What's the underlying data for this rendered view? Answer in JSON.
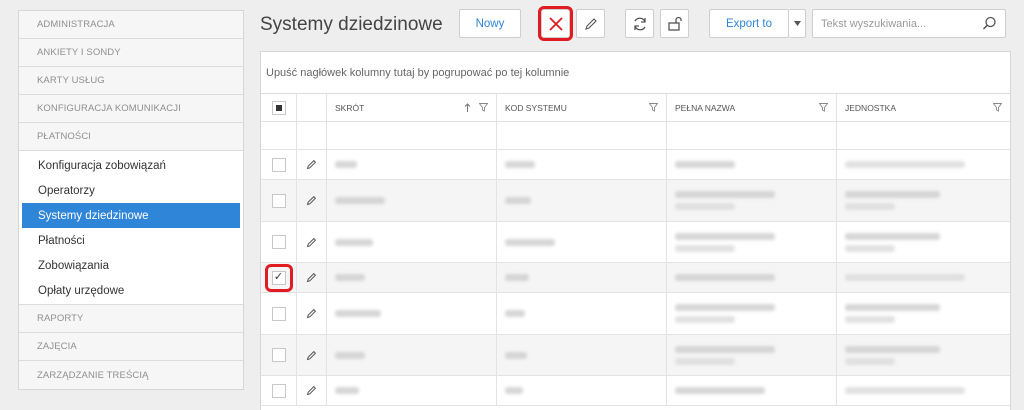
{
  "sidebar": {
    "sections_top": [
      "ADMINISTRACJA",
      "ANKIETY I SONDY",
      "KARTY USŁUG",
      "KONFIGURACJA KOMUNIKACJI",
      "PŁATNOŚCI"
    ],
    "sub_items": [
      {
        "label": "Konfiguracja zobowiązań",
        "active": false
      },
      {
        "label": "Operatorzy",
        "active": false
      },
      {
        "label": "Systemy dziedzinowe",
        "active": true
      },
      {
        "label": "Płatności",
        "active": false
      },
      {
        "label": "Zobowiązania",
        "active": false
      },
      {
        "label": "Opłaty urzędowe",
        "active": false
      }
    ],
    "sections_bottom": [
      "RAPORTY",
      "ZAJĘCIA",
      "ZARZĄDZANIE TREŚCIĄ"
    ]
  },
  "header": {
    "title": "Systemy dziedzinowe",
    "new_label": "Nowy",
    "export_label": "Export to",
    "search_placeholder": "Tekst wyszukiwania..."
  },
  "grid": {
    "group_hint": "Upuść nagłówek kolumny tutaj by pogrupować po tej kolumnie",
    "columns": [
      "SKRÓT",
      "KOD SYSTEMU",
      "PEŁNA NAZWA",
      "JEDNOSTKA"
    ],
    "rows": [
      {
        "checked": false
      },
      {
        "checked": false
      },
      {
        "checked": false
      },
      {
        "checked": true
      },
      {
        "checked": false
      },
      {
        "checked": false
      },
      {
        "checked": false
      }
    ]
  },
  "colors": {
    "accent": "#2f86d8",
    "highlight": "#e11b22"
  },
  "icons": [
    "delete-x-icon",
    "edit-pencil-icon",
    "refresh-icon",
    "unlock-icon",
    "dropdown-caret-icon",
    "search-icon",
    "sort-up-icon",
    "filter-funnel-icon"
  ]
}
